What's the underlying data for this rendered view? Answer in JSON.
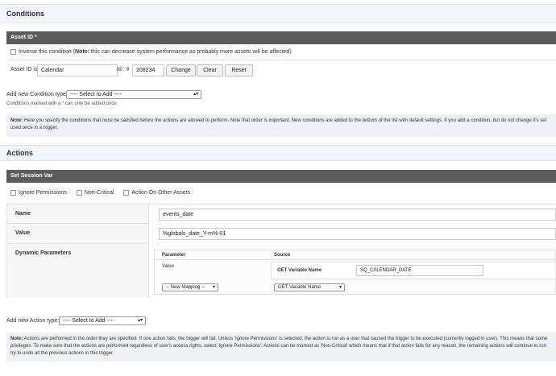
{
  "conditions": {
    "heading": "Conditions",
    "asset_bar": "Asset ID *",
    "inverse_prefix": "Inverse this condition (",
    "inverse_note_label": "Note:",
    "inverse_note_text": " this can decrease system performance as probably more assets will be affected)",
    "asset_id_is_label": "Asset ID is",
    "asset_name_value": "Calendar",
    "id_label": "Id : #",
    "id_value": "208234",
    "change_btn": "Change",
    "clear_btn": "Clear",
    "reset_btn": "Reset",
    "add_condition_label": "Add new Condition type:",
    "add_condition_select": "---- Select to Add ----",
    "marked_note": "Conditions marked with a * can only be added once.",
    "note_label": "Note:",
    "note_text": " Here you specify the conditions that must be satisfied before the actions are allowed to perform. Note that order is important. New conditions are added to the bottom of the list with default settings. If you add a condition, but do not change it's set",
    "note_text2": "used once in a trigger."
  },
  "actions": {
    "heading": "Actions",
    "session_bar": "Set Session Var",
    "ignore_permissions": "Ignore Permissions",
    "non_critical": "Non-Critical",
    "action_on_other": "Action On Other Assets",
    "name_label": "Name",
    "name_value": "events_date",
    "value_label": "Value",
    "value_value": "%globals_date_Y-m%-01",
    "dynamic_label": "Dynamic Parameters",
    "param_header": "Parameter",
    "source_header": "Source",
    "param_value_label": "Value",
    "get_var_label": "GET Variable Name",
    "get_var_value": "SQ_CALENDAR_DATE",
    "new_mapping_select": "-- New Mapping --",
    "get_var_select": "GET Variable Name",
    "add_action_label": "Add new Action type:",
    "add_action_select": "---- Select to Add ----",
    "note_label": "Note:",
    "note_text": " Actions are performed in the order they are specified. If one action fails, the trigger will fail. Unless 'Ignore Permissions' is selected, the action is run as a user that caused the trigger to be executed (currently logged in user). This means that some",
    "note_text2": "privileges. To make sure that the actions are performed regardless of user's access rights, select 'Ignore Permissions'. Actions can be marked as 'Non-Critical' which means that if that action fails for any reason, the remaining actions will continue to run",
    "note_text3": "try to undo all the previous actions in this trigger."
  }
}
